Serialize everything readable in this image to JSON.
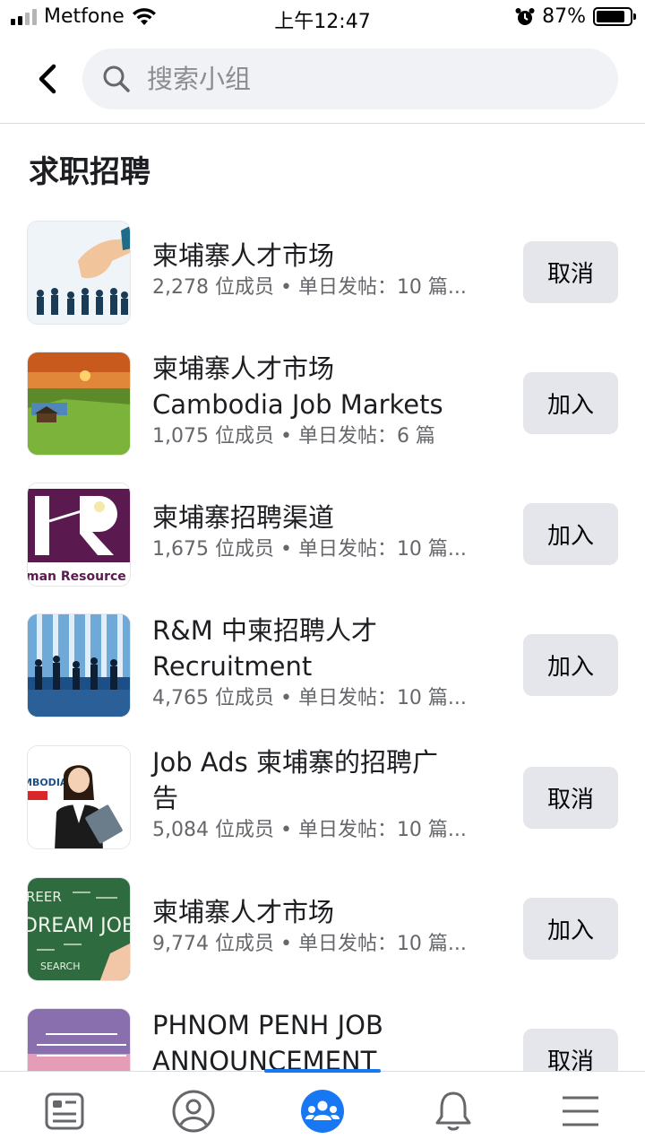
{
  "status_bar": {
    "carrier": "Metfone",
    "time": "上午12:47",
    "battery": "87%",
    "battery_level": 0.87,
    "icons": [
      "signal-icon",
      "wifi-icon",
      "alarm-icon",
      "battery-icon"
    ]
  },
  "search": {
    "placeholder": "搜索小组",
    "value": ""
  },
  "section": {
    "title": "求职招聘"
  },
  "groups": [
    {
      "name": "柬埔寨人才市场",
      "meta": "2,278 位成员 • 单日发帖：10 篇...",
      "action": "取消",
      "thumbnail": "hand-and-people-thumbnail"
    },
    {
      "name": "柬埔寨人才市场\nCambodia Job Markets",
      "meta": "1,075 位成员 • 单日发帖：6 篇",
      "action": "加入",
      "thumbnail": "landscape-thumbnail"
    },
    {
      "name": "柬埔寨招聘渠道",
      "meta": "1,675 位成员 • 单日发帖：10 篇...",
      "action": "加入",
      "thumbnail": "hr-logo-thumbnail"
    },
    {
      "name": "R&M 中柬招聘人才\nRecruitment",
      "meta": "4,765 位成员 • 单日发帖：10 篇...",
      "action": "加入",
      "thumbnail": "business-people-thumbnail"
    },
    {
      "name": "Job Ads 柬埔寨的招聘广\n告",
      "meta": "5,084 位成员 • 单日发帖：10 篇...",
      "action": "取消",
      "thumbnail": "woman-with-folder-thumbnail"
    },
    {
      "name": "柬埔寨人才市场",
      "meta": "9,774 位成员 • 单日发帖：10 篇...",
      "action": "加入",
      "thumbnail": "dream-job-chalkboard-thumbnail"
    },
    {
      "name": "PHNOM PENH JOB\nANNOUNCEMENT",
      "meta": "",
      "action": "取消",
      "thumbnail": "khmer-text-thumbnail"
    }
  ],
  "thumbnail_text": {
    "hr": "man Resource",
    "bodia": "MBODIA",
    "reer": "REER",
    "dream": "DREAM JOB",
    "search": "SEARCH"
  },
  "bottom_nav": {
    "items": [
      "news-feed-icon",
      "profile-icon",
      "groups-icon",
      "notifications-icon",
      "menu-icon"
    ],
    "active": "groups-icon",
    "accent": "#1877f2"
  }
}
